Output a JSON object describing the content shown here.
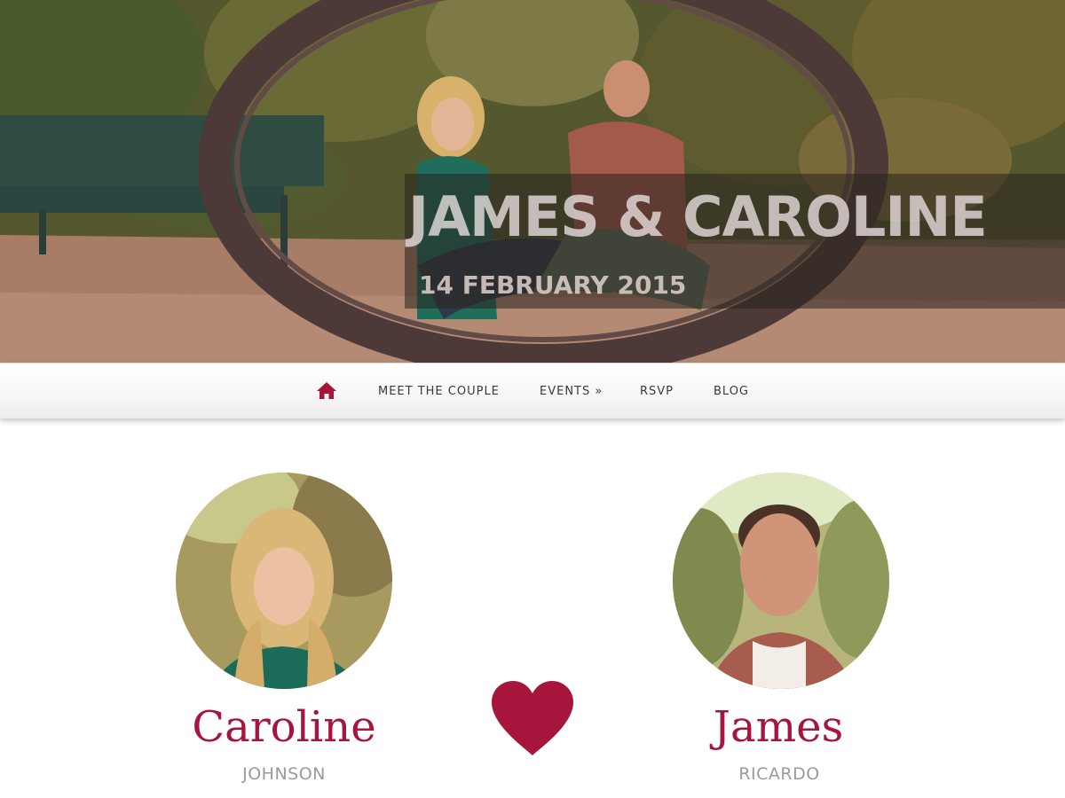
{
  "hero": {
    "title": "JAMES & CAROLINE",
    "date": "14 FEBRUARY 2015"
  },
  "nav": {
    "home_icon": "home-icon",
    "items": [
      {
        "label": "MEET THE COUPLE"
      },
      {
        "label": "EVENTS »"
      },
      {
        "label": "RSVP"
      },
      {
        "label": "BLOG"
      }
    ]
  },
  "couple": {
    "bride": {
      "first_name": "Caroline",
      "last_name": "JOHNSON"
    },
    "groom": {
      "first_name": "James",
      "last_name": "RICARDO"
    },
    "divider_icon": "heart-icon"
  },
  "colors": {
    "accent": "#a6163c",
    "muted_text": "#9b9b9b",
    "nav_text": "#3a3a3a"
  }
}
